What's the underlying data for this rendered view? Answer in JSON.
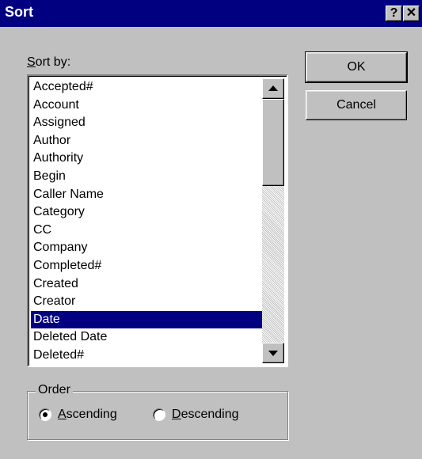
{
  "window": {
    "title": "Sort",
    "help_glyph": "?",
    "close_glyph": "✕"
  },
  "sort_by": {
    "label_accel": "S",
    "label_rest": "ort by:",
    "selected": "Date",
    "items": [
      "Accepted#",
      "Account",
      "Assigned",
      "Author",
      "Authority",
      "Begin",
      "Caller Name",
      "Category",
      "CC",
      "Company",
      "Completed#",
      "Created",
      "Creator",
      "Date",
      "Deleted Date",
      "Deleted#"
    ]
  },
  "buttons": {
    "ok": "OK",
    "cancel": "Cancel"
  },
  "order": {
    "legend": "Order",
    "ascending_accel": "A",
    "ascending_rest": "scending",
    "descending_accel": "D",
    "descending_rest": "escending",
    "selected": "Ascending"
  },
  "colors": {
    "title_bar": "#000080",
    "dialog_bg": "#c0c0c0",
    "selection": "#000080"
  }
}
